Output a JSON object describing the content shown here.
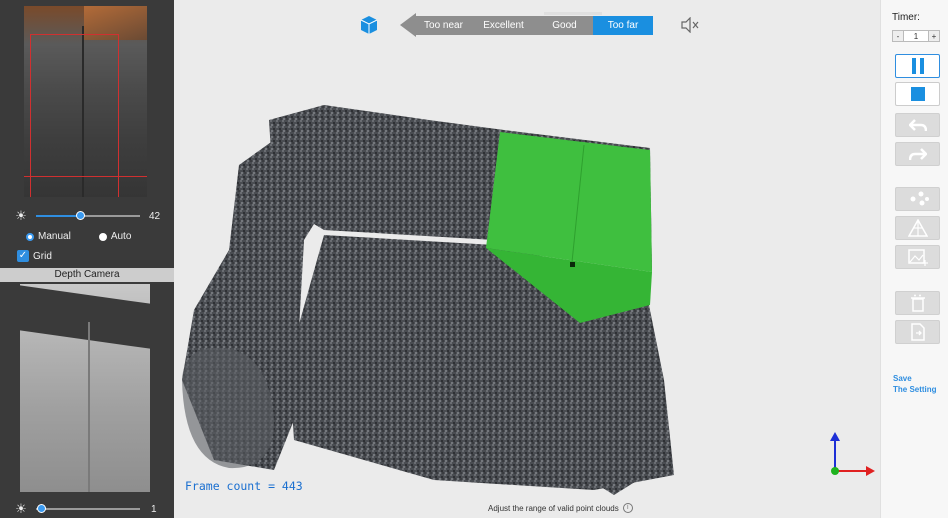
{
  "left_panel": {
    "color_brightness": {
      "value": "42",
      "fill_fraction": 0.43
    },
    "mode": {
      "manual_label": "Manual",
      "auto_label": "Auto",
      "selected": "Manual"
    },
    "grid": {
      "label": "Grid",
      "checked": true
    },
    "depth_camera": {
      "label": "Depth Camera"
    },
    "depth_brightness": {
      "value": "1",
      "fill_fraction": 0.02
    }
  },
  "viewport": {
    "quality_levels": [
      "Too near",
      "Excellent",
      "Good",
      "Too far"
    ],
    "active_quality": "Too far",
    "frame_count": "Frame count = 443",
    "hint": "Adjust the range of valid point clouds",
    "info_glyph": "i"
  },
  "right_panel": {
    "timer_label": "Timer:",
    "timer_minus": "-",
    "timer_value": "1",
    "timer_plus": "+",
    "save_setting_line1": "Save",
    "save_setting_line2": "The Setting"
  },
  "colors": {
    "accent": "#1a8fe0",
    "selection_green": "#3fbf3f",
    "panel_dark": "#3a3a3a"
  },
  "icons": [
    "cube-icon",
    "mute-icon",
    "sun-icon",
    "pause-icon",
    "stop-icon",
    "undo-icon",
    "redo-icon",
    "cluster-icon",
    "mesh-icon",
    "texture-icon",
    "delete-icon",
    "export-icon",
    "info-icon"
  ]
}
